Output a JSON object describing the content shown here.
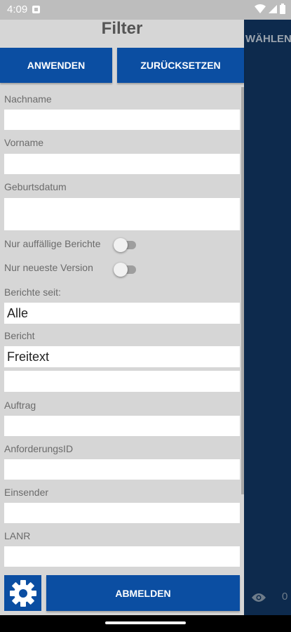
{
  "status_bar": {
    "time": "4:09"
  },
  "background": {
    "header_text": "WÄHLEN",
    "view_count": "0"
  },
  "drawer": {
    "title": "Filter",
    "apply_label": "ANWENDEN",
    "reset_label": "ZURÜCKSETZEN",
    "fields": {
      "nachname": {
        "label": "Nachname",
        "value": ""
      },
      "vorname": {
        "label": "Vorname",
        "value": ""
      },
      "geburtsdatum": {
        "label": "Geburtsdatum",
        "value": ""
      },
      "berichte_seit": {
        "label": "Berichte seit:",
        "value": "Alle"
      },
      "bericht": {
        "label": "Bericht",
        "value": "Freitext",
        "extra_value": ""
      },
      "auftrag": {
        "label": "Auftrag",
        "value": ""
      },
      "anforderungs_id": {
        "label": "AnforderungsID",
        "value": ""
      },
      "einsender": {
        "label": "Einsender",
        "value": ""
      },
      "lanr": {
        "label": "LANR",
        "value": ""
      }
    },
    "toggles": {
      "auffaellige": {
        "label": "Nur auffällige Berichte",
        "on": false
      },
      "neueste": {
        "label": "Nur neueste Version",
        "on": false
      }
    },
    "logout_label": "ABMELDEN"
  }
}
